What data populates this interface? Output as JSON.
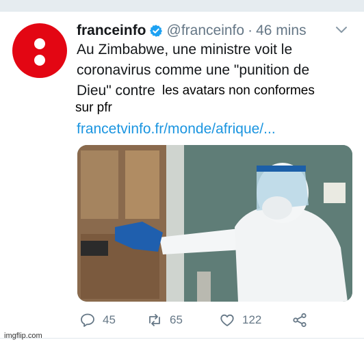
{
  "tweet": {
    "display_name": "franceinfo",
    "handle": "@franceinfo",
    "separator": "·",
    "time": "46 mins",
    "text_lines": [
      "Au Zimbabwe, une ministre voit le",
      "coronavirus comme une \"punition de",
      "Dieu\" contre"
    ],
    "link": "francetvinfo.fr/monde/afrique/...",
    "photo_description": "health worker in protective suit and face shield closing a door"
  },
  "overlay": {
    "line1": "les avatars non conformes",
    "line2": "sur pfr"
  },
  "actions": {
    "reply": {
      "icon": "reply-icon",
      "count": "45"
    },
    "retweet": {
      "icon": "retweet-icon",
      "count": "65"
    },
    "like": {
      "icon": "heart-icon",
      "count": "122"
    },
    "share": {
      "icon": "share-icon"
    }
  },
  "watermark": "imgflip.com",
  "colors": {
    "brand_red": "#e30613",
    "verified_blue": "#1da1f2",
    "link_blue": "#1b95e0",
    "muted_gray": "#657786"
  }
}
